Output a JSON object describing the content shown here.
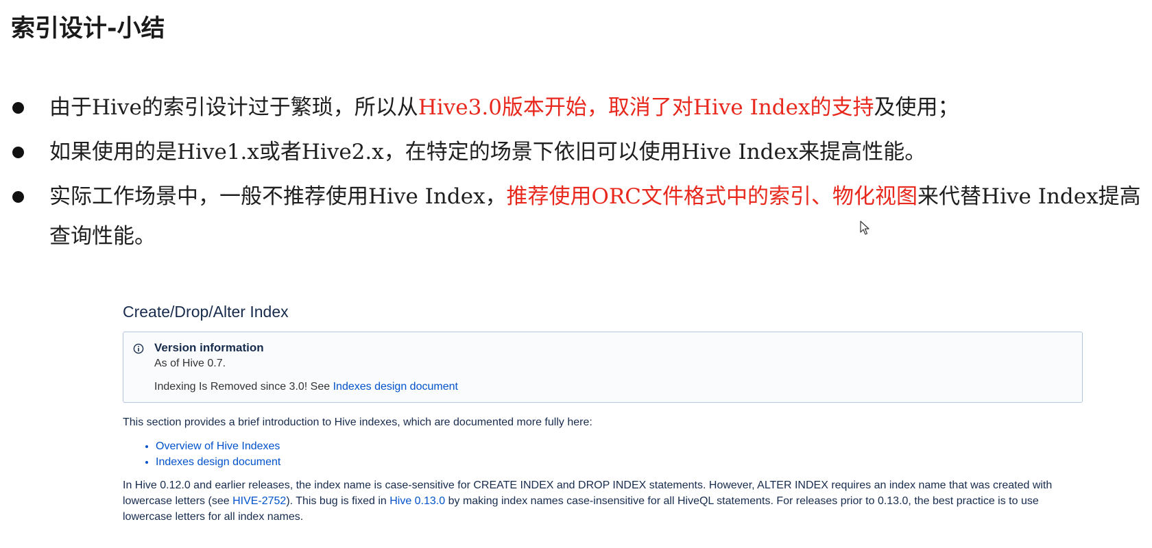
{
  "slide": {
    "title": "索引设计-小结",
    "bullets": [
      {
        "segments": [
          {
            "text": "由于",
            "style": "normal"
          },
          {
            "text": "Hive",
            "style": "en"
          },
          {
            "text": "的索引设计过于繁琐，所以从",
            "style": "normal"
          },
          {
            "text": "Hive3.0",
            "style": "red-en"
          },
          {
            "text": "版本开始，取消了对",
            "style": "red"
          },
          {
            "text": "Hive Index",
            "style": "red-en"
          },
          {
            "text": "的支持",
            "style": "red"
          },
          {
            "text": "及使用；",
            "style": "normal"
          }
        ]
      },
      {
        "segments": [
          {
            "text": "如果使用的是",
            "style": "normal"
          },
          {
            "text": "Hive1.x",
            "style": "en"
          },
          {
            "text": "或者",
            "style": "normal"
          },
          {
            "text": "Hive2.x",
            "style": "en"
          },
          {
            "text": "，在特定的场景下依旧可以使用",
            "style": "normal"
          },
          {
            "text": "Hive Index",
            "style": "en"
          },
          {
            "text": "来提高性能。",
            "style": "normal"
          }
        ]
      },
      {
        "segments": [
          {
            "text": "实际工作场景中，一般不推荐使用",
            "style": "normal"
          },
          {
            "text": "Hive Index",
            "style": "en"
          },
          {
            "text": "，",
            "style": "normal"
          },
          {
            "text": "推荐使用",
            "style": "red"
          },
          {
            "text": "ORC",
            "style": "red-en"
          },
          {
            "text": "文件格式中的索引、物化视图",
            "style": "red"
          },
          {
            "text": "来代替",
            "style": "normal"
          },
          {
            "text": "Hive Index",
            "style": "en"
          },
          {
            "text": "提高查询性能。",
            "style": "normal"
          }
        ]
      }
    ]
  },
  "doc": {
    "heading": "Create/Drop/Alter Index",
    "info_panel": {
      "icon": "info-icon",
      "title": "Version information",
      "line1": "As of Hive 0.7.",
      "line2_prefix": "Indexing Is Removed since 3.0! See ",
      "line2_link": "Indexes design document"
    },
    "intro": "This section provides a brief introduction to Hive indexes, which are documented more fully here:",
    "links": [
      "Overview of Hive Indexes",
      "Indexes design document"
    ],
    "body": {
      "part1": "In Hive 0.12.0 and earlier releases, the index name is case-sensitive for CREATE INDEX and DROP INDEX statements. However, ALTER INDEX requires an index name that was created with lowercase letters (see ",
      "link1": "HIVE-2752",
      "part2": "). This bug is fixed in ",
      "link2": "Hive 0.13.0",
      "part3": " by making index names case-insensitive for all HiveQL statements. For releases prior to 0.13.0, the best practice is to use lowercase letters for all index names."
    }
  },
  "colors": {
    "highlight_red": "#e8281d",
    "link_blue": "#0052cc",
    "panel_border": "#b3c4e0"
  }
}
